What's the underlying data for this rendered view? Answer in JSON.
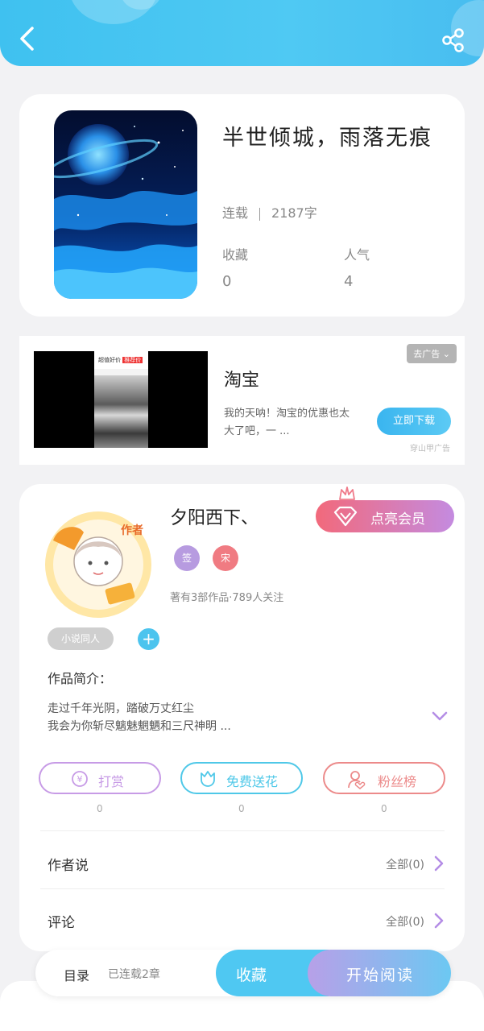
{
  "header": {
    "back_icon": "back-arrow-icon",
    "share_icon": "share-icon"
  },
  "book": {
    "title": "半世倾城，雨落无痕",
    "status": "连载",
    "word_count": "2187字",
    "favorites_label": "收藏",
    "favorites_value": "0",
    "popularity_label": "人气",
    "popularity_value": "4"
  },
  "ad": {
    "title": "淘宝",
    "description": "我的天呐！淘宝的优惠也太大了吧，一 ...",
    "remove_label": "去广告",
    "download_label": "立即下载",
    "source_tag": "穿山甲广告",
    "video_label_1": "超值好价",
    "video_label_2": "推荐价"
  },
  "author": {
    "name": "夕阳西下、",
    "vip_label": "点亮会员",
    "badge_1": "签",
    "badge_2": "宋",
    "meta": "著有3部作品·789人关注",
    "avatar_label": "作者",
    "tag": "小说同人",
    "intro_label": "作品简介：",
    "intro_line_1": "走过千年光阴，踏破万丈红尘",
    "intro_line_2": "我会为你斩尽魑魅魍魉和三尺神明 ..."
  },
  "actions": [
    {
      "label": "打赏",
      "count": "0",
      "icon": "yen-coin-icon",
      "color": "#c79be6"
    },
    {
      "label": "免费送花",
      "count": "0",
      "icon": "flower-icon",
      "color": "#4fc8e8"
    },
    {
      "label": "粉丝榜",
      "count": "0",
      "icon": "fans-user-icon",
      "color": "#ec8a8a"
    }
  ],
  "rows": [
    {
      "label": "作者说",
      "right": "全部(0)"
    },
    {
      "label": "评论",
      "right": "全部(0)"
    }
  ],
  "bottom": {
    "toc_label": "目录",
    "toc_status": "已连载2章",
    "collect_label": "收藏",
    "read_label": "开始阅读"
  },
  "colors": {
    "accent": "#4fc8f2",
    "vip_start": "#f2697b",
    "vip_end": "#c48be0"
  }
}
